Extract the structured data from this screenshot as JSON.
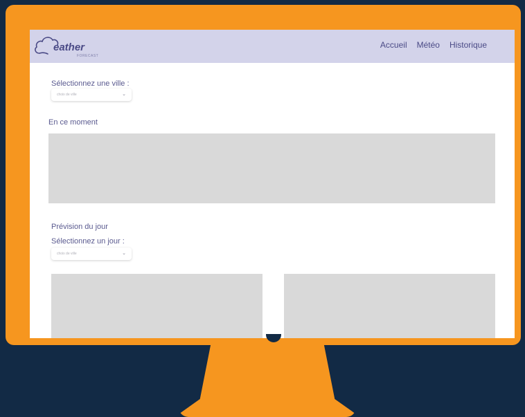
{
  "app": {
    "logo_text": "eather",
    "logo_sub": "FORECAST"
  },
  "nav": {
    "items": [
      {
        "label": "Accueil"
      },
      {
        "label": "Météo"
      },
      {
        "label": "Historique"
      }
    ]
  },
  "city": {
    "label": "Sélectionnez une ville :",
    "placeholder": "choix de ville"
  },
  "now": {
    "heading": "En ce moment"
  },
  "forecast": {
    "heading": "Prévision du jour",
    "day_label": "Sélectionnez un jour :",
    "placeholder": "choix de ville"
  },
  "colors": {
    "background": "#122a45",
    "monitor": "#f6961f",
    "navbar": "#d3d3ea",
    "text": "#4a4a86",
    "panel": "#d9d9d9"
  }
}
